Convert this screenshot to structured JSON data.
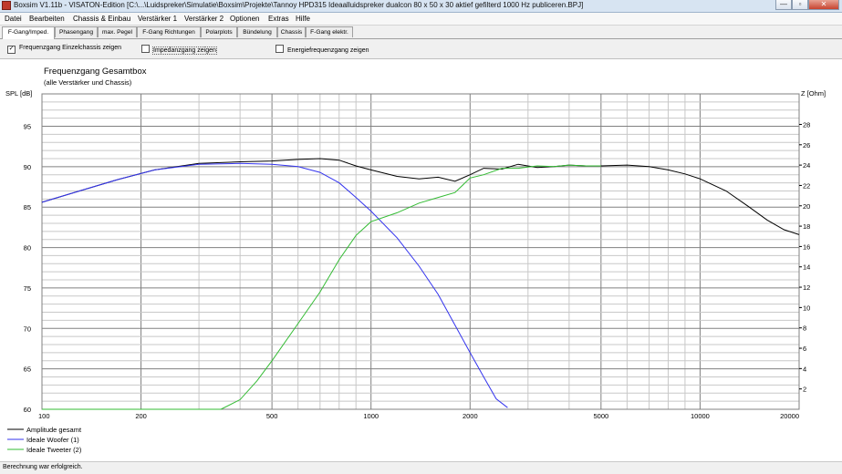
{
  "window": {
    "title": "Boxsim V1.11b - VISATON-Edition [C:\\...\\Luidspreker\\Simulatie\\Boxsim\\Projekte\\Tannoy HPD315 Ideaalluidspreker dualcon 80 x 50 x 30 aktief gefilterd 1000 Hz publiceren.BPJ]",
    "minimize_glyph": "—",
    "maximize_glyph": "▫",
    "close_glyph": "✕"
  },
  "menu": [
    "Datei",
    "Bearbeiten",
    "Chassis & Einbau",
    "Verstärker 1",
    "Verstärker 2",
    "Optionen",
    "Extras",
    "Hilfe"
  ],
  "tabs": [
    "F-Gang/Imped.",
    "Phasengang",
    "max. Pegel",
    "F-Gang Richtungen",
    "Polarplots",
    "Bündelung",
    "Chassis",
    "F-Gang elektr."
  ],
  "options": {
    "single_chassis": {
      "label": "Frequenzgang Einzelchassis zeigen",
      "checked": true,
      "mark": "✓"
    },
    "impedance": {
      "label": "Impedanzgang zeigen",
      "checked": false
    },
    "energy": {
      "label": "Energiefrequenzgang zeigen",
      "checked": false
    }
  },
  "status": "Berechnung war erfolgreich.",
  "colors": {
    "total": "#000000",
    "woofer": "#3333ee",
    "tweeter": "#33bb33",
    "grid": "#c8c8c8",
    "grid_major": "#808080"
  },
  "chart_data": {
    "type": "line",
    "title": "Frequenzgang Gesamtbox",
    "subtitle": "(alle Verstärker und Chassis)",
    "ylabel": "SPL [dB]",
    "y2label": "Z [Ohm]",
    "x_scale": "log",
    "xlim": [
      100,
      20000
    ],
    "ylim": [
      60,
      99
    ],
    "y2lim": [
      0,
      31
    ],
    "x_ticks": [
      100,
      200,
      500,
      1000,
      2000,
      5000,
      10000,
      20000
    ],
    "y_ticks": [
      60,
      65,
      70,
      75,
      80,
      85,
      90,
      95
    ],
    "y2_ticks": [
      2,
      4,
      6,
      8,
      10,
      12,
      14,
      16,
      18,
      20,
      22,
      24,
      26,
      28
    ],
    "grid": true,
    "legend_position": "bottom-left",
    "series": [
      {
        "name": "Amplitude gesamt",
        "x": [
          100,
          130,
          170,
          220,
          300,
          400,
          500,
          600,
          700,
          800,
          900,
          1000,
          1200,
          1400,
          1600,
          1800,
          2000,
          2200,
          2500,
          2800,
          3200,
          3600,
          4000,
          4500,
          5000,
          6000,
          7000,
          8000,
          9000,
          10000,
          12000,
          14000,
          16000,
          18000,
          20000
        ],
        "y": [
          85.6,
          87.0,
          88.4,
          89.6,
          90.4,
          90.6,
          90.7,
          90.9,
          91.0,
          90.8,
          90.1,
          89.6,
          88.8,
          88.5,
          88.7,
          88.2,
          89.0,
          89.8,
          89.7,
          90.3,
          89.9,
          90.0,
          90.2,
          90.1,
          90.1,
          90.2,
          90.0,
          89.6,
          89.1,
          88.5,
          87.0,
          85.1,
          83.4,
          82.2,
          81.6
        ]
      },
      {
        "name": "Ideale Woofer (1)",
        "x": [
          100,
          130,
          170,
          220,
          300,
          400,
          500,
          600,
          700,
          800,
          900,
          1000,
          1200,
          1400,
          1600,
          1800,
          2000,
          2200,
          2400,
          2600
        ],
        "y": [
          85.6,
          87.0,
          88.4,
          89.6,
          90.3,
          90.4,
          90.3,
          90.0,
          89.3,
          88.0,
          86.2,
          84.5,
          81.2,
          77.7,
          74.2,
          70.4,
          67.0,
          64.0,
          61.3,
          60.2
        ]
      },
      {
        "name": "Ideale Tweeter (2)",
        "x": [
          100,
          200,
          300,
          350,
          400,
          450,
          500,
          600,
          700,
          800,
          900,
          1000,
          1200,
          1400,
          1600,
          1800,
          2000,
          2200,
          2500,
          2800,
          3200,
          3600,
          4000,
          4500,
          5000
        ],
        "y": [
          60,
          60,
          60,
          60,
          61.2,
          63.5,
          66.0,
          70.6,
          74.5,
          78.5,
          81.5,
          83.2,
          84.3,
          85.5,
          86.2,
          86.8,
          88.6,
          89.0,
          89.8,
          89.8,
          90.1,
          90.0,
          90.2,
          90.1,
          90.1
        ]
      }
    ]
  }
}
